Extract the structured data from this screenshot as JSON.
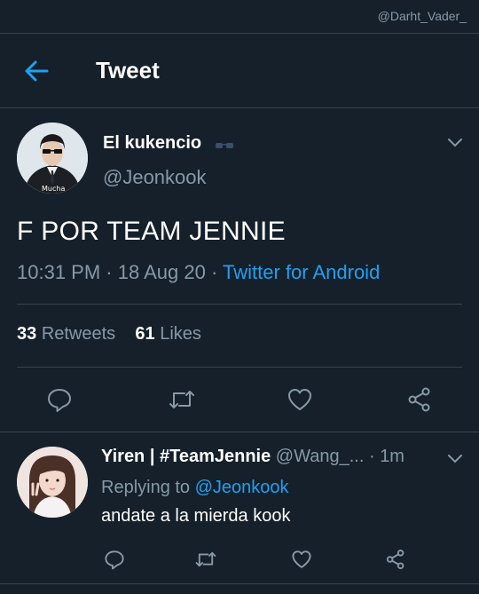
{
  "watermark": "@Darht_Vader_",
  "header": {
    "title": "Tweet"
  },
  "tweet": {
    "author_name": "El kukencio",
    "author_handle": "@Jeonkook",
    "text": "F POR TEAM JENNIE",
    "time": "10:31 PM",
    "sep1": " · ",
    "date": "18 Aug 20",
    "sep2": " · ",
    "source": "Twitter for Android",
    "retweets_count": "33",
    "retweets_label": "Retweets",
    "likes_count": "61",
    "likes_label": "Likes",
    "avatar_caption": "Mucha"
  },
  "reply": {
    "author_name": "Yiren | #TeamJennie",
    "author_handle": "@Wang_...",
    "time_sep": " · ",
    "time": "1m",
    "replying_label": "Replying to",
    "replying_to": "@Jeonkook",
    "text": "andate a la mierda kook"
  },
  "colors": {
    "background": "#15202b",
    "accent": "#1da1f2",
    "secondary_text": "#8899a6",
    "divider": "#38444d"
  },
  "icons": [
    "back-arrow-icon",
    "chevron-down-icon",
    "sunglasses-icon",
    "reply-icon",
    "retweet-icon",
    "like-icon",
    "share-icon"
  ]
}
